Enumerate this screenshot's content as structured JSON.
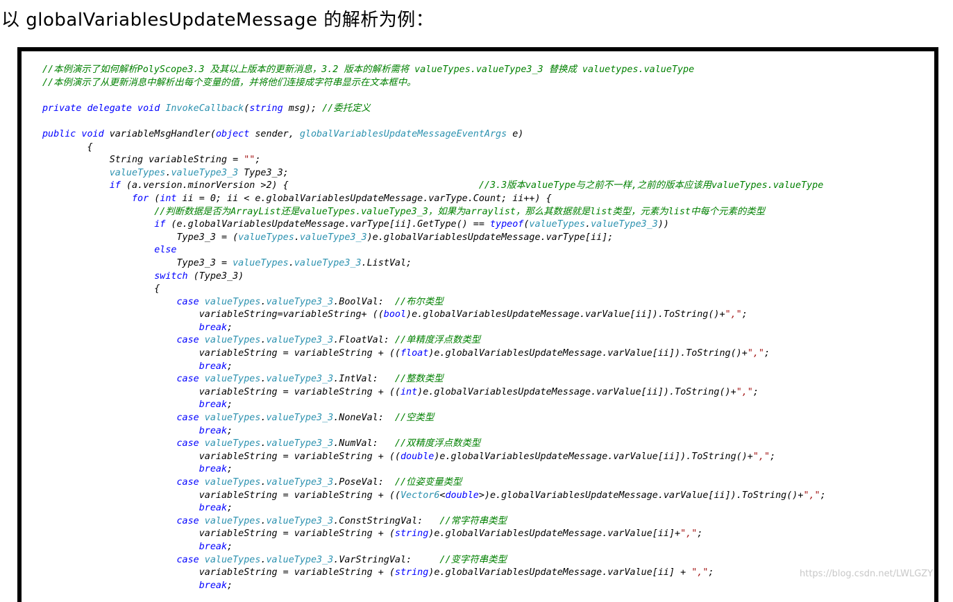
{
  "heading": "以 globalVariablesUpdateMessage 的解析为例：",
  "watermark": "https://blog.csdn.net/LWLGZY",
  "colors": {
    "comment": "#008000",
    "keyword": "#0000ff",
    "type": "#2b91af",
    "string": "#a31515",
    "plain": "#000000"
  },
  "code_lines": [
    [
      [
        "c",
        "//本例演示了如何解析PolyScope3.3 及其以上版本的更新消息，3.2 版本的解析需将 valueTypes.valueType3_3 替换成 valuetypes.valueType"
      ]
    ],
    [
      [
        "c",
        "//本例演示了从更新消息中解析出每个变量的值，并将他们连接成字符串显示在文本框中。"
      ]
    ],
    [],
    [
      [
        "k",
        "private delegate void "
      ],
      [
        "t",
        "InvokeCallback"
      ],
      [
        "p",
        "("
      ],
      [
        "k",
        "string"
      ],
      [
        "p",
        " msg); "
      ],
      [
        "c",
        "//委托定义"
      ]
    ],
    [],
    [
      [
        "k",
        "public void "
      ],
      [
        "p",
        "variableMsgHandler("
      ],
      [
        "k",
        "object"
      ],
      [
        "p",
        " sender, "
      ],
      [
        "t",
        "globalVariablesUpdateMessageEventArgs"
      ],
      [
        "p",
        " e)"
      ]
    ],
    [
      [
        "p",
        "        {"
      ]
    ],
    [
      [
        "p",
        "            String variableString = "
      ],
      [
        "s",
        "\"\""
      ],
      [
        "p",
        ";"
      ]
    ],
    [
      [
        "p",
        "            "
      ],
      [
        "t",
        "valueTypes"
      ],
      [
        "p",
        "."
      ],
      [
        "t",
        "valueType3_3"
      ],
      [
        "p",
        " Type3_3;"
      ]
    ],
    [
      [
        "p",
        "            "
      ],
      [
        "k",
        "if"
      ],
      [
        "p",
        " (a.version.minorVersion >2) {                                  "
      ],
      [
        "c",
        "//3.3版本valueType与之前不一样,之前的版本应该用valueTypes.valueType"
      ]
    ],
    [
      [
        "p",
        "                "
      ],
      [
        "k",
        "for"
      ],
      [
        "p",
        " ("
      ],
      [
        "k",
        "int"
      ],
      [
        "p",
        " ii = 0; ii < e.globalVariablesUpdateMessage.varType.Count; ii++) {"
      ]
    ],
    [
      [
        "p",
        "                    "
      ],
      [
        "c",
        "//判断数据是否为ArrayList还是valueTypes.valueType3_3，如果为arraylist，那么其数据就是list类型，元素为list中每个元素的类型"
      ]
    ],
    [
      [
        "p",
        "                    "
      ],
      [
        "k",
        "if"
      ],
      [
        "p",
        " (e.globalVariablesUpdateMessage.varType[ii].GetType() == "
      ],
      [
        "k",
        "typeof"
      ],
      [
        "p",
        "("
      ],
      [
        "t",
        "valueTypes"
      ],
      [
        "p",
        "."
      ],
      [
        "t",
        "valueType3_3"
      ],
      [
        "p",
        "))"
      ]
    ],
    [
      [
        "p",
        "                        Type3_3 = ("
      ],
      [
        "t",
        "valueTypes"
      ],
      [
        "p",
        "."
      ],
      [
        "t",
        "valueType3_3"
      ],
      [
        "p",
        ")e.globalVariablesUpdateMessage.varType[ii];"
      ]
    ],
    [
      [
        "p",
        "                    "
      ],
      [
        "k",
        "else"
      ]
    ],
    [
      [
        "p",
        "                        Type3_3 = "
      ],
      [
        "t",
        "valueTypes"
      ],
      [
        "p",
        "."
      ],
      [
        "t",
        "valueType3_3"
      ],
      [
        "p",
        ".ListVal;"
      ]
    ],
    [
      [
        "p",
        "                    "
      ],
      [
        "k",
        "switch"
      ],
      [
        "p",
        " (Type3_3)"
      ]
    ],
    [
      [
        "p",
        "                    {"
      ]
    ],
    [
      [
        "p",
        "                        "
      ],
      [
        "k",
        "case "
      ],
      [
        "t",
        "valueTypes"
      ],
      [
        "p",
        "."
      ],
      [
        "t",
        "valueType3_3"
      ],
      [
        "p",
        ".BoolVal:  "
      ],
      [
        "c",
        "//布尔类型"
      ]
    ],
    [
      [
        "p",
        "                            variableString=variableString+ (("
      ],
      [
        "k",
        "bool"
      ],
      [
        "p",
        ")e.globalVariablesUpdateMessage.varValue[ii]).ToString()+"
      ],
      [
        "s",
        "\",\""
      ],
      [
        "p",
        ";"
      ]
    ],
    [
      [
        "p",
        "                            "
      ],
      [
        "k",
        "break"
      ],
      [
        "p",
        ";"
      ]
    ],
    [
      [
        "p",
        "                        "
      ],
      [
        "k",
        "case "
      ],
      [
        "t",
        "valueTypes"
      ],
      [
        "p",
        "."
      ],
      [
        "t",
        "valueType3_3"
      ],
      [
        "p",
        ".FloatVal: "
      ],
      [
        "c",
        "//单精度浮点数类型"
      ]
    ],
    [
      [
        "p",
        "                            variableString = variableString + (("
      ],
      [
        "k",
        "float"
      ],
      [
        "p",
        ")e.globalVariablesUpdateMessage.varValue[ii]).ToString()+"
      ],
      [
        "s",
        "\",\""
      ],
      [
        "p",
        ";"
      ]
    ],
    [
      [
        "p",
        "                            "
      ],
      [
        "k",
        "break"
      ],
      [
        "p",
        ";"
      ]
    ],
    [
      [
        "p",
        "                        "
      ],
      [
        "k",
        "case "
      ],
      [
        "t",
        "valueTypes"
      ],
      [
        "p",
        "."
      ],
      [
        "t",
        "valueType3_3"
      ],
      [
        "p",
        ".IntVal:   "
      ],
      [
        "c",
        "//整数类型"
      ]
    ],
    [
      [
        "p",
        "                            variableString = variableString + (("
      ],
      [
        "k",
        "int"
      ],
      [
        "p",
        ")e.globalVariablesUpdateMessage.varValue[ii]).ToString()+"
      ],
      [
        "s",
        "\",\""
      ],
      [
        "p",
        ";"
      ]
    ],
    [
      [
        "p",
        "                            "
      ],
      [
        "k",
        "break"
      ],
      [
        "p",
        ";"
      ]
    ],
    [
      [
        "p",
        "                        "
      ],
      [
        "k",
        "case "
      ],
      [
        "t",
        "valueTypes"
      ],
      [
        "p",
        "."
      ],
      [
        "t",
        "valueType3_3"
      ],
      [
        "p",
        ".NoneVal:  "
      ],
      [
        "c",
        "//空类型"
      ]
    ],
    [
      [
        "p",
        "                            "
      ],
      [
        "k",
        "break"
      ],
      [
        "p",
        ";"
      ]
    ],
    [
      [
        "p",
        "                        "
      ],
      [
        "k",
        "case "
      ],
      [
        "t",
        "valueTypes"
      ],
      [
        "p",
        "."
      ],
      [
        "t",
        "valueType3_3"
      ],
      [
        "p",
        ".NumVal:   "
      ],
      [
        "c",
        "//双精度浮点数类型"
      ]
    ],
    [
      [
        "p",
        "                            variableString = variableString + (("
      ],
      [
        "k",
        "double"
      ],
      [
        "p",
        ")e.globalVariablesUpdateMessage.varValue[ii]).ToString()+"
      ],
      [
        "s",
        "\",\""
      ],
      [
        "p",
        ";"
      ]
    ],
    [
      [
        "p",
        "                            "
      ],
      [
        "k",
        "break"
      ],
      [
        "p",
        ";"
      ]
    ],
    [
      [
        "p",
        "                        "
      ],
      [
        "k",
        "case "
      ],
      [
        "t",
        "valueTypes"
      ],
      [
        "p",
        "."
      ],
      [
        "t",
        "valueType3_3"
      ],
      [
        "p",
        ".PoseVal:  "
      ],
      [
        "c",
        "//位姿变量类型"
      ]
    ],
    [
      [
        "p",
        "                            variableString = variableString + (("
      ],
      [
        "t",
        "Vector6"
      ],
      [
        "p",
        "<"
      ],
      [
        "k",
        "double"
      ],
      [
        "p",
        ">)e.globalVariablesUpdateMessage.varValue[ii]).ToString()+"
      ],
      [
        "s",
        "\",\""
      ],
      [
        "p",
        ";"
      ]
    ],
    [
      [
        "p",
        "                            "
      ],
      [
        "k",
        "break"
      ],
      [
        "p",
        ";"
      ]
    ],
    [
      [
        "p",
        "                        "
      ],
      [
        "k",
        "case "
      ],
      [
        "t",
        "valueTypes"
      ],
      [
        "p",
        "."
      ],
      [
        "t",
        "valueType3_3"
      ],
      [
        "p",
        ".ConstStringVal:   "
      ],
      [
        "c",
        "//常字符串类型"
      ]
    ],
    [
      [
        "p",
        "                            variableString = variableString + ("
      ],
      [
        "k",
        "string"
      ],
      [
        "p",
        ")e.globalVariablesUpdateMessage.varValue[ii]+"
      ],
      [
        "s",
        "\",\""
      ],
      [
        "p",
        ";"
      ]
    ],
    [
      [
        "p",
        "                            "
      ],
      [
        "k",
        "break"
      ],
      [
        "p",
        ";"
      ]
    ],
    [
      [
        "p",
        "                        "
      ],
      [
        "k",
        "case "
      ],
      [
        "t",
        "valueTypes"
      ],
      [
        "p",
        "."
      ],
      [
        "t",
        "valueType3_3"
      ],
      [
        "p",
        ".VarStringVal:     "
      ],
      [
        "c",
        "//变字符串类型"
      ]
    ],
    [
      [
        "p",
        "                            variableString = variableString + ("
      ],
      [
        "k",
        "string"
      ],
      [
        "p",
        ")e.globalVariablesUpdateMessage.varValue[ii] + "
      ],
      [
        "s",
        "\",\""
      ],
      [
        "p",
        ";"
      ]
    ],
    [
      [
        "p",
        "                            "
      ],
      [
        "k",
        "break"
      ],
      [
        "p",
        ";"
      ]
    ]
  ]
}
